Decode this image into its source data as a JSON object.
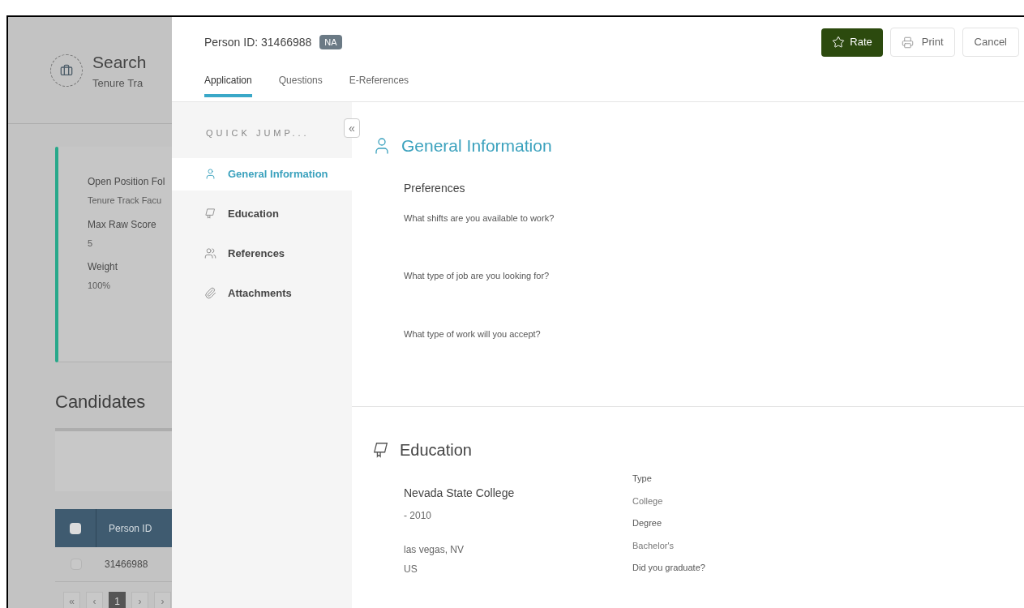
{
  "background_page": {
    "title": "Search",
    "subtitle": "Tenure Tra",
    "details": [
      {
        "label": "Open Position Fol",
        "value": "Tenure Track Facu"
      },
      {
        "label": "Max Raw Score",
        "value": "5"
      },
      {
        "label": "Weight",
        "value": "100%"
      }
    ],
    "candidates_title": "Candidates",
    "table": {
      "header_checked": false,
      "columns": [
        "Person ID"
      ],
      "rows": [
        {
          "checked": false,
          "cells": [
            "31466988"
          ]
        }
      ]
    },
    "pagination": [
      {
        "label": "«",
        "selected": false
      },
      {
        "label": "‹",
        "selected": false
      },
      {
        "label": "1",
        "selected": true
      },
      {
        "label": "›",
        "selected": false
      },
      {
        "label": "›",
        "selected": false
      }
    ]
  },
  "modal": {
    "person_id": "Person ID: 31466988",
    "badge": "NA",
    "buttons": [
      {
        "kind": "primary",
        "label": "Rate"
      },
      {
        "kind": "print",
        "label": "Print"
      },
      {
        "kind": "plain",
        "label": "Cancel"
      }
    ],
    "tabs": [
      {
        "label": "Application",
        "selected": true
      },
      {
        "label": "Questions",
        "selected": false
      },
      {
        "label": "E-References",
        "selected": false
      }
    ],
    "quick_jump": {
      "title": "QUICK JUMP...",
      "collapse": "«",
      "items": [
        {
          "label": "General Information",
          "selected": true
        },
        {
          "label": "Education",
          "selected": false
        },
        {
          "label": "References",
          "selected": false
        },
        {
          "label": "Attachments",
          "selected": false
        }
      ]
    },
    "general_information": {
      "heading": "General Information",
      "subheading": "Preferences",
      "questions": [
        "What shifts are you available to work?",
        "What type of job are you looking for?",
        "What type of work will you accept?"
      ]
    },
    "education": {
      "heading": "Education",
      "school": "Nevada State College",
      "years": "- 2010",
      "location": [
        "las vegas, NV",
        "US"
      ],
      "fields": [
        {
          "kind": "label",
          "text": "Type"
        },
        {
          "kind": "value",
          "text": "College"
        },
        {
          "kind": "label",
          "text": "Degree"
        },
        {
          "kind": "value",
          "text": "Bachelor's"
        },
        {
          "kind": "label",
          "text": "Did you graduate?"
        }
      ]
    }
  }
}
